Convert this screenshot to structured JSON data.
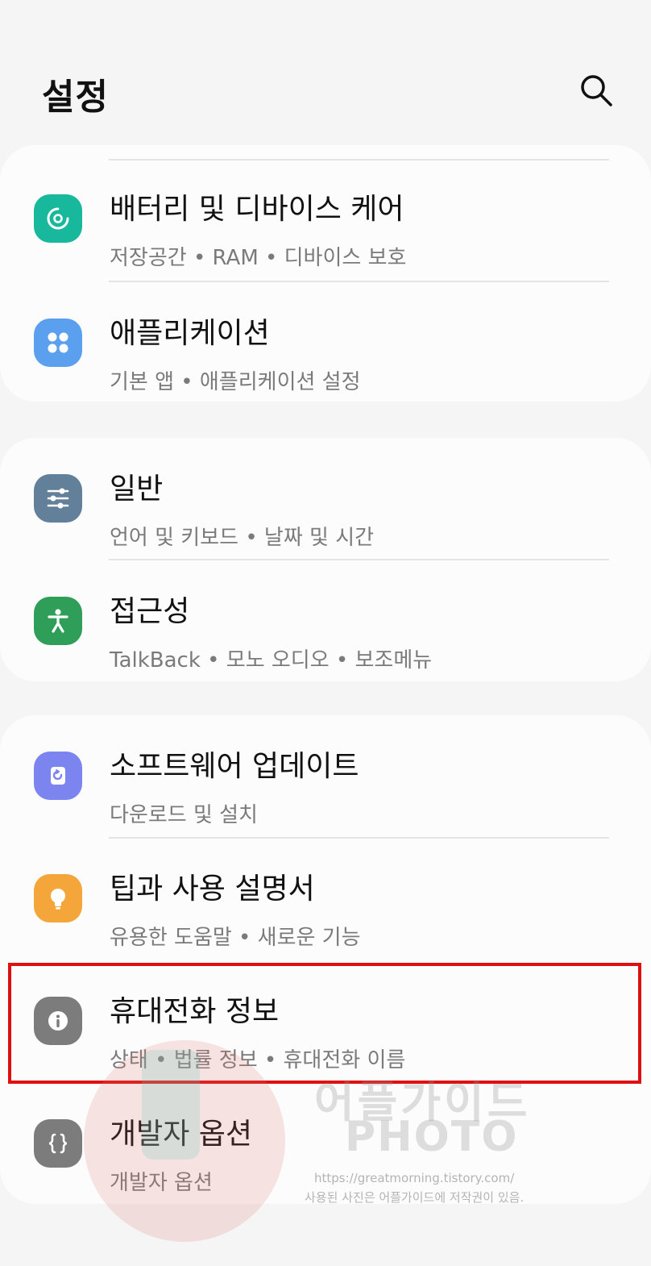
{
  "header": {
    "title": "설정",
    "search_icon": "search-icon"
  },
  "items": [
    {
      "label": "배터리 및 디바이스 케어",
      "sub": "저장공간 • RAM • 디바이스 보호",
      "icon": "device-care-icon",
      "color": "#17b89b"
    },
    {
      "label": "애플리케이션",
      "sub": "기본 앱 • 애플리케이션 설정",
      "icon": "apps-icon",
      "color": "#5aa0ee"
    },
    {
      "label": "일반",
      "sub": "언어 및 키보드 • 날짜 및 시간",
      "icon": "general-sliders-icon",
      "color": "#63809a"
    },
    {
      "label": "접근성",
      "sub": "TalkBack • 모노 오디오 • 보조메뉴",
      "icon": "accessibility-icon",
      "color": "#2e9e58"
    },
    {
      "label": "소프트웨어 업데이트",
      "sub": "다운로드 및 설치",
      "icon": "software-update-icon",
      "color": "#7b84ef"
    },
    {
      "label": "팁과 사용 설명서",
      "sub": "유용한 도움말 • 새로운 기능",
      "icon": "tips-bulb-icon",
      "color": "#f5a63b"
    },
    {
      "label": "휴대전화 정보",
      "sub": "상태 • 법률 정보 • 휴대전화 이름",
      "icon": "info-icon",
      "color": "#7c7c7c"
    },
    {
      "label": "개발자 옵션",
      "sub": "개발자 옵션",
      "icon": "developer-braces-icon",
      "color": "#7c7c7c"
    }
  ],
  "watermark": {
    "logo": "어플가이드",
    "photo": "PHOTO",
    "url": "https://greatmorning.tistory.com/",
    "note": "사용된 사진은 어플가이드에 저작권이 있음."
  }
}
